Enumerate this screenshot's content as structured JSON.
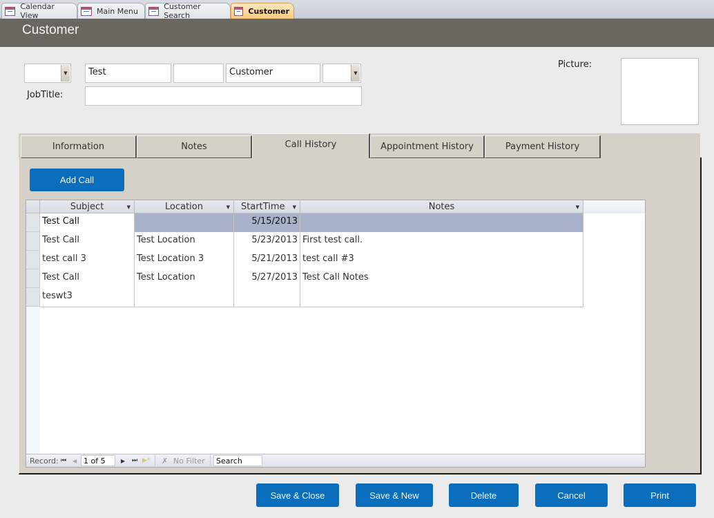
{
  "doc_tabs": [
    {
      "label": "Calendar View",
      "icon": "form-icon",
      "active": false
    },
    {
      "label": "Main Menu",
      "icon": "form-icon",
      "active": false
    },
    {
      "label": "Customer Search",
      "icon": "form-icon",
      "active": false
    },
    {
      "label": "Customer",
      "icon": "form-icon",
      "active": true
    }
  ],
  "header": {
    "title": "Customer"
  },
  "fields": {
    "title_combo": {
      "value": ""
    },
    "first_name": {
      "value": "Test"
    },
    "middle_name": {
      "value": ""
    },
    "last_name": {
      "value": "Customer"
    },
    "suffix_combo": {
      "value": ""
    },
    "job_title_label": "JobTitle:",
    "job_title": {
      "value": ""
    },
    "picture_label": "Picture:"
  },
  "tabs": [
    {
      "label": "Information",
      "active": false
    },
    {
      "label": "Notes",
      "active": false
    },
    {
      "label": "Call History",
      "active": true
    },
    {
      "label": "Appointment History",
      "active": false
    },
    {
      "label": "Payment History",
      "active": false
    }
  ],
  "call_history": {
    "add_call_label": "Add Call",
    "columns": [
      "Subject",
      "Location",
      "StartTime",
      "Notes"
    ],
    "rows": [
      {
        "subject": "Test Call",
        "location": "",
        "start_time": "5/15/2013",
        "notes": "",
        "selected": true
      },
      {
        "subject": "Test Call",
        "location": "Test Location",
        "start_time": "5/23/2013",
        "notes": "First test call."
      },
      {
        "subject": "test call 3",
        "location": "Test Location 3",
        "start_time": "5/21/2013",
        "notes": "test call #3"
      },
      {
        "subject": "Test Call",
        "location": "Test Location",
        "start_time": "5/27/2013",
        "notes": "Test Call Notes"
      },
      {
        "subject": "teswt3",
        "location": "",
        "start_time": "",
        "notes": ""
      }
    ],
    "navigator": {
      "record_label": "Record:",
      "position": "1 of 5",
      "filter_label": "No Filter",
      "search_placeholder": "Search"
    }
  },
  "actions": {
    "save_close": "Save & Close",
    "save_new": "Save & New",
    "delete": "Delete",
    "cancel": "Cancel",
    "print": "Print"
  },
  "colors": {
    "accent_button": "#0a6ebd",
    "header_band": "#6a6761",
    "selected_row": "#aab2cb",
    "active_doc_tab": "#f9c97f"
  }
}
